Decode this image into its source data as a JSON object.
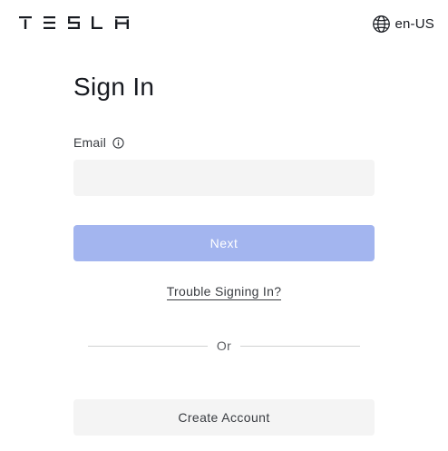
{
  "header": {
    "logo_icon": "tesla-wordmark",
    "locale_icon": "globe-icon",
    "locale_label": "en-US"
  },
  "main": {
    "title": "Sign In",
    "email": {
      "label": "Email",
      "info_icon": "info-icon",
      "value": "",
      "placeholder": ""
    },
    "next_label": "Next",
    "trouble_label": "Trouble Signing In?",
    "divider_label": "Or",
    "create_account_label": "Create Account"
  },
  "colors": {
    "text_primary": "#171a20",
    "next_button_bg": "#a3b5ef",
    "input_bg": "#f4f4f4",
    "secondary_button_bg": "#f4f4f4",
    "divider": "#d0d1d2"
  }
}
